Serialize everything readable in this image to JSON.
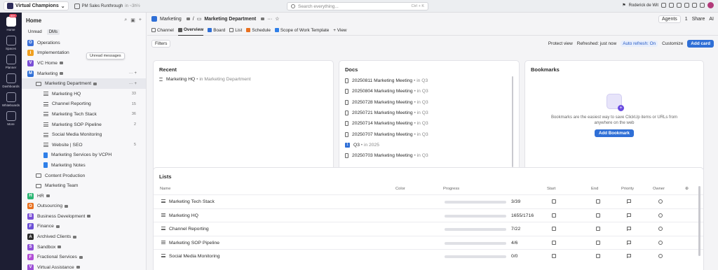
{
  "topbar": {
    "workspace": "Virtual Champions",
    "meeting_title": "PM Sales Runthrough",
    "meeting_time": "in ~3h½",
    "search_placeholder": "Search everything...",
    "search_shortcut": "Ctrl + K",
    "user_name": "Roderick de Wit"
  },
  "rail": {
    "badge": "99+",
    "items": [
      "Home",
      "Spaces",
      "Planner",
      "Dashboards",
      "Whiteboards",
      "More"
    ]
  },
  "sidebar": {
    "title": "Home",
    "tabs": [
      "Unread",
      "DMs"
    ],
    "tooltip": "Unread messages",
    "items": [
      {
        "label": "Operations",
        "kind": "space",
        "letter": "O",
        "color": "#3a6fd8"
      },
      {
        "label": "Implementation",
        "kind": "space",
        "letter": "I",
        "color": "#f0a020"
      },
      {
        "label": "VC Home",
        "kind": "space",
        "letter": "V",
        "color": "#7a4fd6",
        "lock": true
      },
      {
        "label": "Marketing",
        "kind": "space",
        "letter": "M",
        "color": "#2f6fd6",
        "lock": true
      },
      {
        "label": "Marketing Department",
        "kind": "folder",
        "lock": true,
        "selected": true
      },
      {
        "label": "Marketing HQ",
        "kind": "list",
        "count": "33"
      },
      {
        "label": "Channel Reporting",
        "kind": "list",
        "count": "15"
      },
      {
        "label": "Marketing Tech Stack",
        "kind": "list",
        "count": "36"
      },
      {
        "label": "Marketing SOP Pipeline",
        "kind": "list",
        "count": "2"
      },
      {
        "label": "Social Media Monitoring",
        "kind": "list",
        "count": ""
      },
      {
        "label": "Website | SEO",
        "kind": "list",
        "count": "5"
      },
      {
        "label": "Marketing Services by VCPH",
        "kind": "doc",
        "count": ""
      },
      {
        "label": "Marketing Notes",
        "kind": "doc",
        "count": ""
      },
      {
        "label": "Content Production",
        "kind": "folder2"
      },
      {
        "label": "Marketing Team",
        "kind": "folder2"
      },
      {
        "label": "HR",
        "kind": "space",
        "letter": "H",
        "color": "#2bb673",
        "lock": true
      },
      {
        "label": "Outsourcing",
        "kind": "space",
        "letter": "O",
        "color": "#e8701f",
        "lock": true
      },
      {
        "label": "Business Development",
        "kind": "space",
        "letter": "B",
        "color": "#7a4fd6",
        "lock": true
      },
      {
        "label": "Finance",
        "kind": "space",
        "letter": "F",
        "color": "#6b4fd6",
        "lock": true
      },
      {
        "label": "Archived Clients",
        "kind": "space",
        "letter": "A",
        "color": "#2b2b2b",
        "lock": true
      },
      {
        "label": "Sandbox",
        "kind": "space",
        "letter": "S",
        "color": "#8d4fd6",
        "lock": true
      },
      {
        "label": "Fractional Services",
        "kind": "space",
        "letter": "F",
        "color": "#b24fd6",
        "lock": true
      },
      {
        "label": "Virtual Assistance",
        "kind": "space",
        "letter": "V",
        "color": "#9c4fd6",
        "lock": true
      }
    ]
  },
  "main": {
    "breadcrumb": [
      "Marketing",
      "Marketing Department"
    ],
    "agents": "Agents",
    "agents_count": "1",
    "share": "Share",
    "ai": "AI",
    "tabs": [
      "Channel",
      "Overview",
      "Board",
      "List",
      "Schedule",
      "Scope of Work Template",
      "+ View"
    ],
    "active_tab": "Overview",
    "filters": "Filters",
    "protect_view": "Protect view",
    "refreshed": "Refreshed: just now",
    "auto_refresh": "Auto refresh: On",
    "customize": "Customize",
    "add_card": "Add card"
  },
  "recent": {
    "title": "Recent",
    "items": [
      {
        "name": "Marketing HQ",
        "where": "• in Marketing Department"
      }
    ]
  },
  "docs": {
    "title": "Docs",
    "items": [
      {
        "name": "20250811 Marketing Meeting",
        "where": "• in Q3"
      },
      {
        "name": "20250804 Marketing Meeting",
        "where": "• in Q3"
      },
      {
        "name": "20250728 Marketing Meeting",
        "where": "• in Q3"
      },
      {
        "name": "20250721 Marketing Meeting",
        "where": "• in Q3"
      },
      {
        "name": "20250714 Marketing Meeting",
        "where": "• in Q3"
      },
      {
        "name": "20250707 Marketing Meeting",
        "where": "• in Q3"
      },
      {
        "name": "Q3",
        "where": "• in 2025",
        "badge": "1"
      },
      {
        "name": "20250703 Marketing Meeting",
        "where": "• in Q3"
      }
    ]
  },
  "bookmarks": {
    "title": "Bookmarks",
    "text": "Bookmarks are the easiest way to save ClickUp items or URLs from anywhere on the web",
    "button": "Add Bookmark"
  },
  "lists": {
    "title": "Lists",
    "columns": [
      "Name",
      "Color",
      "Progress",
      "Start",
      "End",
      "Priority",
      "Owner"
    ],
    "rows": [
      {
        "name": "Marketing Tech Stack",
        "progress": "3/39",
        "fraction": 0.077
      },
      {
        "name": "Marketing HQ",
        "progress": "1655/1716",
        "fraction": 0.964
      },
      {
        "name": "Channel Reporting",
        "progress": "7/22",
        "fraction": 0.318
      },
      {
        "name": "Marketing SOP Pipeline",
        "progress": "4/6",
        "fraction": 0.667
      },
      {
        "name": "Social Media Monitoring",
        "progress": "0/0",
        "fraction": 0
      }
    ]
  }
}
